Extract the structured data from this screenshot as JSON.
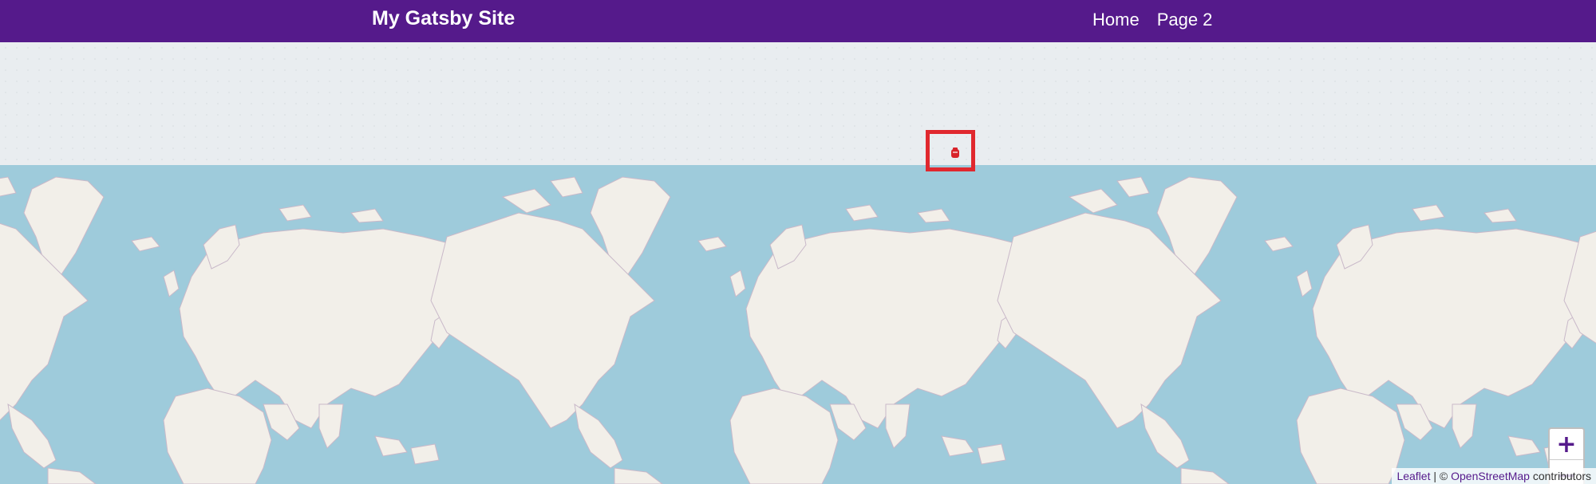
{
  "header": {
    "site_title": "My Gatsby Site",
    "nav": [
      {
        "label": "Home"
      },
      {
        "label": "Page 2"
      }
    ],
    "background_color": "#551a8b"
  },
  "map": {
    "zoom_in_label": "+",
    "zoom_out_label": "−",
    "attribution": {
      "leaflet": "Leaflet",
      "separator": "| ©",
      "osm": "OpenStreetMap",
      "contributors": "contributors"
    },
    "marker_icon": "map-marker-icon",
    "ocean_color": "#9ecbdb",
    "land_color": "#f2efe9",
    "highlight_color": "#e0282e"
  }
}
